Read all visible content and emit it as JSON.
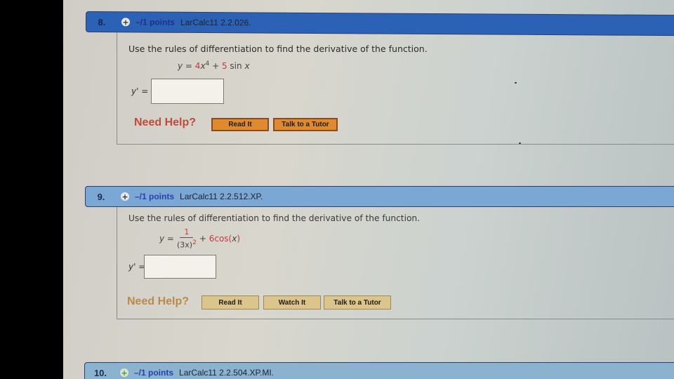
{
  "questions": [
    {
      "number": "8.",
      "points": "–/1 points",
      "code": "LarCalc11 2.2.026.",
      "prompt": "Use the rules of differentiation to find the derivative of the function.",
      "formula": {
        "lhs": "y = ",
        "term1_coef": "4",
        "term1_var": "x",
        "term1_exp": "4",
        "plus1": " + ",
        "term2_coef": "5",
        "term2_rest": " sin ",
        "term2_var": "x"
      },
      "answer_label": "y' =",
      "answer_value": "",
      "need_help": "Need Help?",
      "buttons": [
        "Read It",
        "Talk to a Tutor"
      ]
    },
    {
      "number": "9.",
      "points": "–/1 points",
      "code": "LarCalc11 2.2.512.XP.",
      "prompt": "Use the rules of differentiation to find the derivative of the function.",
      "formula": {
        "lhs": "y = ",
        "numerator": "1",
        "denominator_base": "(3x)",
        "denominator_exp": "2",
        "plus": " + ",
        "term2_coef": "6",
        "term2_rest": " cos(",
        "term2_var": "x",
        "term2_close": ")"
      },
      "answer_label": "y' =",
      "answer_value": "",
      "need_help": "Need Help?",
      "buttons": [
        "Read It",
        "Watch It",
        "Talk to a Tutor"
      ]
    },
    {
      "number": "10.",
      "points": "–/1 points",
      "code": "LarCalc11 2.2.504.XP.MI."
    }
  ],
  "icons": {
    "expand": "+"
  }
}
